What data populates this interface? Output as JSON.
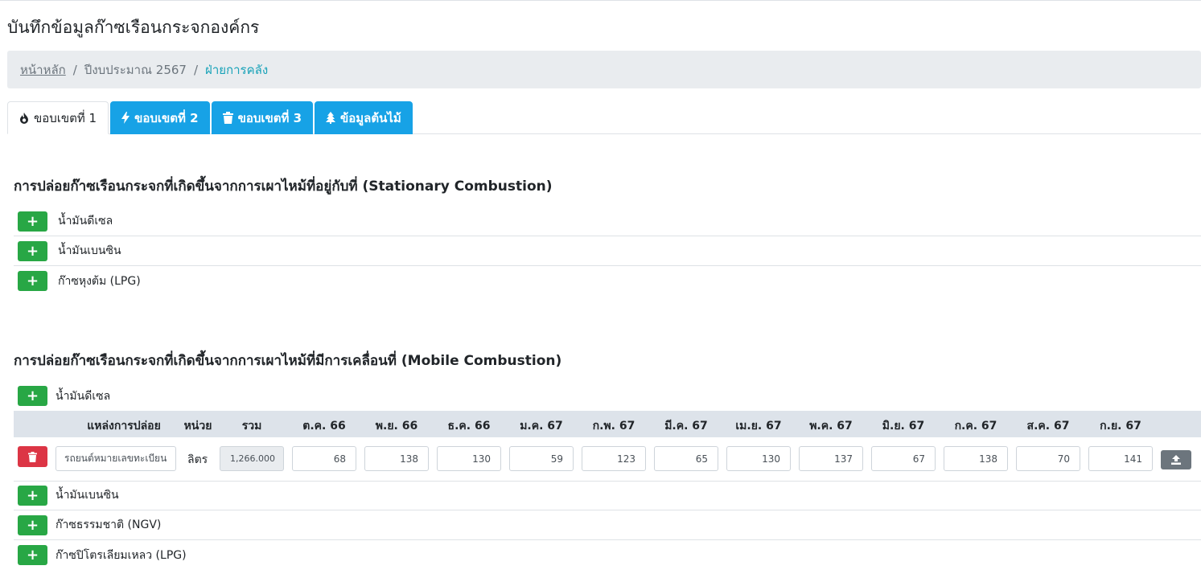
{
  "page_title": "บันทึกข้อมูลก๊าซเรือนกระจกองค์กร",
  "breadcrumb": {
    "home": "หน้าหลัก",
    "year": "ปีงบประมาณ 2567",
    "department": "ฝ่ายการคลัง"
  },
  "tabs": [
    {
      "label": "ขอบเขตที่ 1",
      "icon": "fire-icon",
      "active": true
    },
    {
      "label": "ขอบเขตที่ 2",
      "icon": "bolt-icon",
      "active": false
    },
    {
      "label": "ขอบเขตที่ 3",
      "icon": "trash-icon",
      "active": false
    },
    {
      "label": "ข้อมูลต้นไม้",
      "icon": "tree-icon",
      "active": false
    }
  ],
  "stationary": {
    "title": "การปล่อยก๊าซเรือนกระจกที่เกิดขึ้นจากการเผาไหม้ที่อยู่กับที่ (Stationary Combustion)",
    "items": [
      "น้ำมันดีเซล",
      "น้ำมันเบนซิน",
      "ก๊าซหุงต้ม (LPG)"
    ]
  },
  "mobile": {
    "title": "การปล่อยก๊าซเรือนกระจกที่เกิดขึ้นจากการเผาไหม้ที่มีการเคลื่อนที่ (Mobile Combustion)",
    "items": [
      "น้ำมันดีเซล",
      "น้ำมันเบนซิน",
      "ก๊าซธรรมชาติ (NGV)",
      "ก๊าซปิโตรเลียมเหลว (LPG)"
    ],
    "table": {
      "headers": {
        "source": "แหล่งการปล่อย",
        "unit": "หน่วย",
        "total": "รวม",
        "months": [
          "ต.ค. 66",
          "พ.ย. 66",
          "ธ.ค. 66",
          "ม.ค. 67",
          "ก.พ. 67",
          "มี.ค. 67",
          "เม.ย. 67",
          "พ.ค. 67",
          "มิ.ย. 67",
          "ก.ค. 67",
          "ส.ค. 67",
          "ก.ย. 67"
        ]
      },
      "row": {
        "source_placeholder": "รถยนต์หมายเลขทะเบียน",
        "unit": "ลิตร",
        "total": "1,266.000",
        "values": [
          "68",
          "138",
          "130",
          "59",
          "123",
          "65",
          "130",
          "137",
          "67",
          "138",
          "70",
          "141"
        ]
      }
    }
  },
  "colors": {
    "add_button": "#28a745",
    "delete_button": "#dc3545",
    "tab_info": "#17a2e6",
    "upload_button": "#6c757d",
    "breadcrumb_active": "#17a2b8"
  }
}
